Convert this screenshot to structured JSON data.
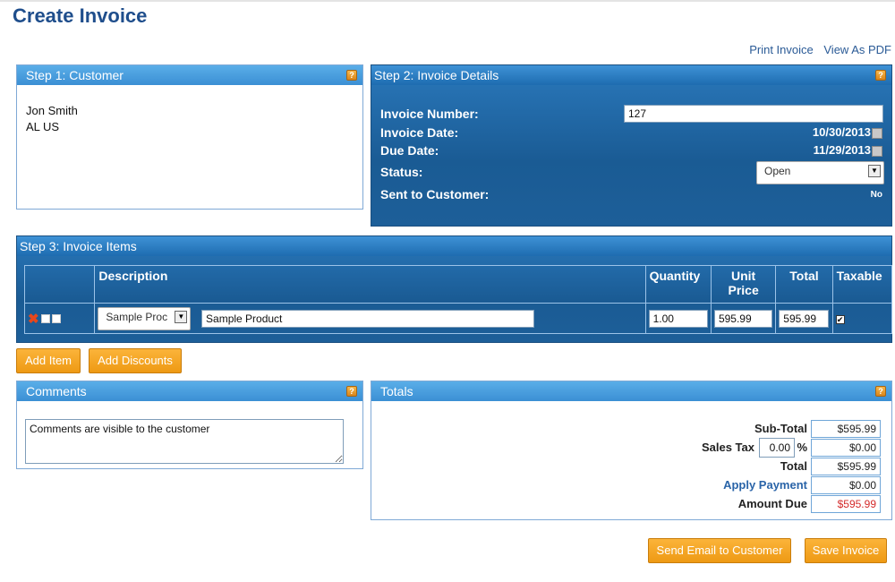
{
  "page_title": "Create Invoice",
  "top_links": {
    "print": "Print Invoice",
    "pdf": "View As PDF"
  },
  "help_glyph": "?",
  "customer": {
    "header": "Step 1: Customer",
    "name": "Jon Smith",
    "location": "AL US"
  },
  "details": {
    "header": "Step 2: Invoice Details",
    "invoice_number_label": "Invoice Number:",
    "invoice_number": "127",
    "invoice_date_label": "Invoice Date:",
    "invoice_date": "10/30/2013",
    "due_date_label": "Due Date:",
    "due_date": "11/29/2013",
    "status_label": "Status:",
    "status": "Open",
    "sent_label": "Sent to Customer:",
    "sent": "No"
  },
  "items": {
    "header": "Step 3: Invoice Items",
    "columns": {
      "description": "Description",
      "quantity": "Quantity",
      "unit_price": "Unit Price",
      "total": "Total",
      "taxable": "Taxable"
    },
    "rows": [
      {
        "product": "Sample Proc",
        "description": "Sample Product",
        "quantity": "1.00",
        "unit_price": "595.99",
        "total": "595.99",
        "taxable": true
      }
    ]
  },
  "buttons": {
    "add_item": "Add Item",
    "add_discounts": "Add Discounts",
    "send_email": "Send Email to Customer",
    "save_invoice": "Save Invoice"
  },
  "comments": {
    "header": "Comments",
    "text": "Comments are visible to the customer"
  },
  "totals": {
    "header": "Totals",
    "subtotal_label": "Sub-Total",
    "subtotal": "$595.99",
    "sales_tax_label": "Sales Tax",
    "sales_tax_rate": "0.00",
    "percent": "%",
    "sales_tax": "$0.00",
    "total_label": "Total",
    "total": "$595.99",
    "apply_payment_label": "Apply Payment",
    "apply_payment": "$0.00",
    "amount_due_label": "Amount Due",
    "amount_due": "$595.99"
  },
  "colors": {
    "accent": "#1f4e8c",
    "button": "#f2a222",
    "panel_header": "#3b8fd4",
    "amount_due": "#d42a2a"
  }
}
